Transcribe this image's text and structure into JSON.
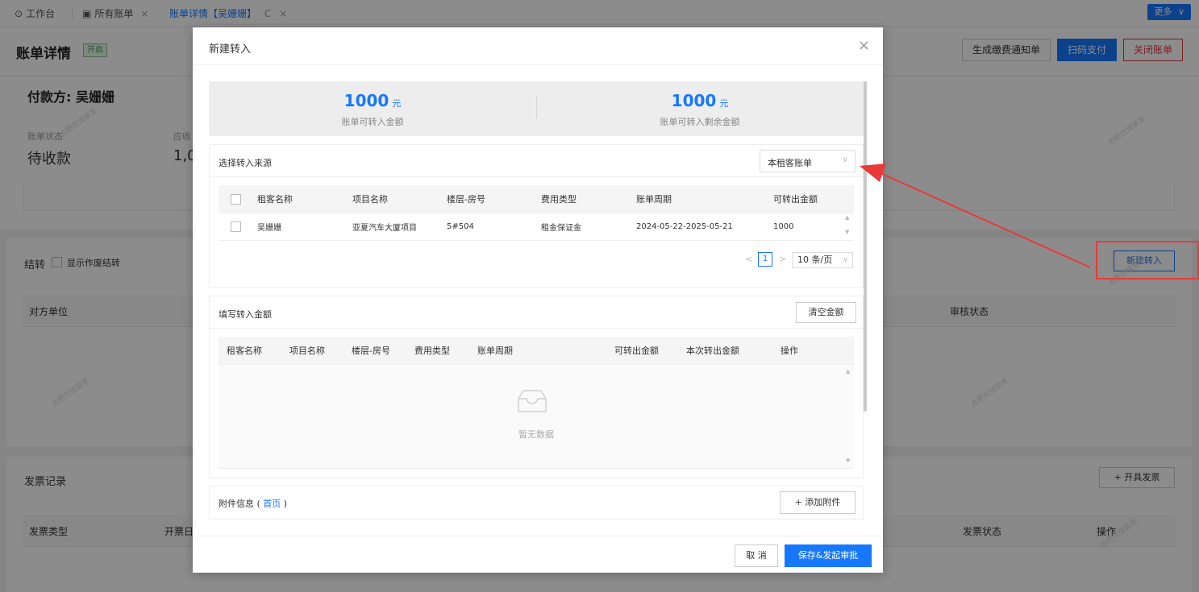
{
  "tabs": [
    {
      "icon": "⊙",
      "label": "工作台"
    },
    {
      "icon": "▣",
      "label": "所有账单",
      "close": "×"
    },
    {
      "label": "账单详情【吴姗姗】",
      "refresh": "C",
      "close": "×"
    }
  ],
  "more_label": "更多",
  "more_arrow": "∨",
  "header": {
    "title": "账单详情",
    "badge": "开启",
    "btn_notice": "生成缴费通知单",
    "btn_scan": "扫码支付",
    "btn_close": "关闭账单"
  },
  "payer_card": {
    "payer": "付款方: 吴姗姗",
    "status_label": "账单状态",
    "status_value": "待收款",
    "receivable_label": "应收",
    "receivable_value": "1,0"
  },
  "carry": {
    "title": "结转",
    "show_void_label": "显示作废结转",
    "btn_new": "新建转入",
    "col_counterparty": "对方单位",
    "col_audit": "审核状态"
  },
  "invoice": {
    "title": "发票记录",
    "btn_issue": "+ 开具发票",
    "col_type": "发票类型",
    "col_date": "开票日",
    "col_status": "发票状态",
    "col_action": "操作"
  },
  "watermark": "合肥优铺管家",
  "modal": {
    "title": "新建转入",
    "close": "×",
    "summary": [
      {
        "amount": "1000",
        "unit": "元",
        "label": "账单可转入金额"
      },
      {
        "amount": "1000",
        "unit": "元",
        "label": "账单可转入剩余金额"
      }
    ],
    "source": {
      "title": "选择转入来源",
      "select_value": "本租客账单",
      "select_arrow": "∨",
      "columns": [
        "租客名称",
        "项目名称",
        "楼层-房号",
        "费用类型",
        "账单周期",
        "可转出金额"
      ],
      "rows": [
        [
          "吴姗姗",
          "亚夏汽车大厦项目",
          "5#504",
          "租金保证金",
          "2024-05-22-2025-05-21",
          "1000"
        ]
      ],
      "pager": {
        "prev": "<",
        "page": "1",
        "next": ">",
        "size": "10 条/页",
        "size_arrow": "∨"
      }
    },
    "amount": {
      "title": "填写转入金额",
      "btn_clear": "清空金额",
      "columns": [
        "租客名称",
        "项目名称",
        "楼层-房号",
        "费用类型",
        "账单周期",
        "可转出金额",
        "本次转出金额",
        "操作"
      ],
      "empty_text": "暂无数据"
    },
    "attach": {
      "label_prefix": "附件信息 (",
      "link": "首页",
      "label_suffix": ")",
      "btn_add": "+ 添加附件"
    },
    "footer": {
      "cancel": "取 消",
      "submit": "保存&发起审批"
    }
  },
  "colors": {
    "primary": "#1677ff",
    "danger": "#e0383e",
    "annotation": "#e83a3a"
  }
}
